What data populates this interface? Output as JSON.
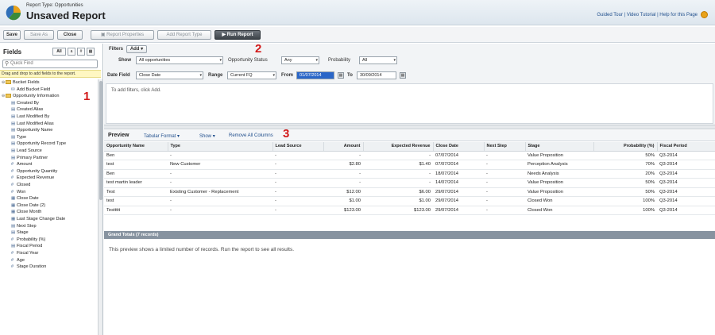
{
  "header": {
    "report_type": "Report Type: Opportunities",
    "title": "Unsaved Report",
    "links": "Guided Tour | Video Tutorial | Help for this Page"
  },
  "toolbar": {
    "save": "Save",
    "save_as": "Save As",
    "close": "Close",
    "report_properties": "Report Properties",
    "add_report_type": "Add Report Type",
    "run_report": "Run Report"
  },
  "fields_panel": {
    "title": "Fields",
    "view_all": "All",
    "quick_find_placeholder": "Quick Find",
    "hint": "Drag and drop to add fields to the report.",
    "tree": [
      {
        "label": "Bucket Fields",
        "icon": "folder",
        "level": 0
      },
      {
        "label": "Add Bucket Field",
        "icon": "bucket",
        "level": 1
      },
      {
        "label": "Opportunity Information",
        "icon": "folder",
        "level": 0
      },
      {
        "label": "Created By",
        "icon": "text",
        "level": 1
      },
      {
        "label": "Created Alias",
        "icon": "text",
        "level": 1
      },
      {
        "label": "Last Modified By",
        "icon": "text",
        "level": 1
      },
      {
        "label": "Last Modified Alias",
        "icon": "text",
        "level": 1
      },
      {
        "label": "Opportunity Name",
        "icon": "text",
        "level": 1
      },
      {
        "label": "Type",
        "icon": "text",
        "level": 1
      },
      {
        "label": "Opportunity Record Type",
        "icon": "text",
        "level": 1
      },
      {
        "label": "Lead Source",
        "icon": "text",
        "level": 1
      },
      {
        "label": "Primary Partner",
        "icon": "text",
        "level": 1
      },
      {
        "label": "Amount",
        "icon": "number",
        "level": 1
      },
      {
        "label": "Opportunity Quantity",
        "icon": "number",
        "level": 1
      },
      {
        "label": "Expected Revenue",
        "icon": "number",
        "level": 1
      },
      {
        "label": "Closed",
        "icon": "number",
        "level": 1
      },
      {
        "label": "Won",
        "icon": "number",
        "level": 1
      },
      {
        "label": "Close Date",
        "icon": "date",
        "level": 1
      },
      {
        "label": "Close Date (2)",
        "icon": "date",
        "level": 1
      },
      {
        "label": "Close Month",
        "icon": "date",
        "level": 1
      },
      {
        "label": "Last Stage Change Date",
        "icon": "date",
        "level": 1
      },
      {
        "label": "Next Step",
        "icon": "text",
        "level": 1
      },
      {
        "label": "Stage",
        "icon": "text",
        "level": 1
      },
      {
        "label": "Probability (%)",
        "icon": "number",
        "level": 1
      },
      {
        "label": "Fiscal Period",
        "icon": "text",
        "level": 1
      },
      {
        "label": "Fiscal Year",
        "icon": "number",
        "level": 1
      },
      {
        "label": "Age",
        "icon": "number",
        "level": 1
      },
      {
        "label": "Stage Duration",
        "icon": "number",
        "level": 1
      }
    ]
  },
  "filters": {
    "title": "Filters",
    "add": "Add",
    "show_label": "Show",
    "show_value": "All opportunities",
    "status_label": "Opportunity Status",
    "status_value": "Any",
    "probability_label": "Probability",
    "probability_value": "All",
    "date_field_label": "Date Field",
    "date_field_value": "Close Date",
    "range_label": "Range",
    "range_value": "Current FQ",
    "from_label": "From",
    "from_value": "01/07/2014",
    "to_label": "To",
    "to_value": "30/09/2014",
    "hint": "To add filters, click Add."
  },
  "annotations": [
    "1",
    "2",
    "3"
  ],
  "preview": {
    "title": "Preview",
    "format": "Tabular Format",
    "show": "Show",
    "remove_all": "Remove All Columns",
    "columns": [
      "Opportunity Name",
      "Type",
      "Lead Source",
      "Amount",
      "Expected Revenue",
      "Close Date",
      "Next Step",
      "Stage",
      "Probability (%)",
      "Fiscal Period"
    ],
    "rows": [
      [
        "Ben",
        "-",
        "-",
        "-",
        "-",
        "07/07/2014",
        "-",
        "Value Proposition",
        "50%",
        "Q3-2014"
      ],
      [
        "test",
        "New Customer",
        "-",
        "$2.80",
        "$1.40",
        "07/07/2014",
        "-",
        "Perception Analysis",
        "70%",
        "Q3-2014"
      ],
      [
        "Ben",
        "-",
        "-",
        "-",
        "-",
        "18/07/2014",
        "-",
        "Needs Analysis",
        "20%",
        "Q3-2014"
      ],
      [
        "test martin leader",
        "-",
        "-",
        "-",
        "-",
        "14/07/2014",
        "-",
        "Value Proposition",
        "50%",
        "Q3-2014"
      ],
      [
        "Test",
        "Existing Customer - Replacement",
        "-",
        "$12.00",
        "$6.00",
        "29/07/2014",
        "-",
        "Value Proposition",
        "50%",
        "Q3-2014"
      ],
      [
        "test",
        "-",
        "-",
        "$1.00",
        "$1.00",
        "29/07/2014",
        "-",
        "Closed Won",
        "100%",
        "Q3-2014"
      ],
      [
        "Testtttt",
        "-",
        "-",
        "$123.00",
        "$123.00",
        "29/07/2014",
        "-",
        "Closed Won",
        "100%",
        "Q3-2014"
      ]
    ],
    "grand_totals": "Grand Totals (7 records)",
    "note": "This preview shows a limited number of records. Run the report to see all results."
  }
}
